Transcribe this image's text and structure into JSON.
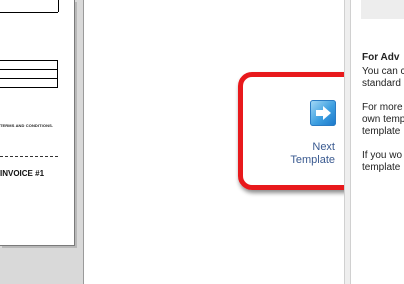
{
  "preview": {
    "terms_text": "TERMS AND CONDITIONS.",
    "invoice_text": "INVOICE #1"
  },
  "next_template": {
    "label_line1": "Next",
    "label_line2": "Template",
    "icon": "arrow-right-icon",
    "highlight_color": "#e8191c"
  },
  "help": {
    "heading": "For Adv",
    "paragraphs": [
      [
        "You can c",
        "standard"
      ],
      [
        "For more",
        "own temp",
        "template"
      ],
      [
        "If you wo",
        "template"
      ]
    ]
  }
}
